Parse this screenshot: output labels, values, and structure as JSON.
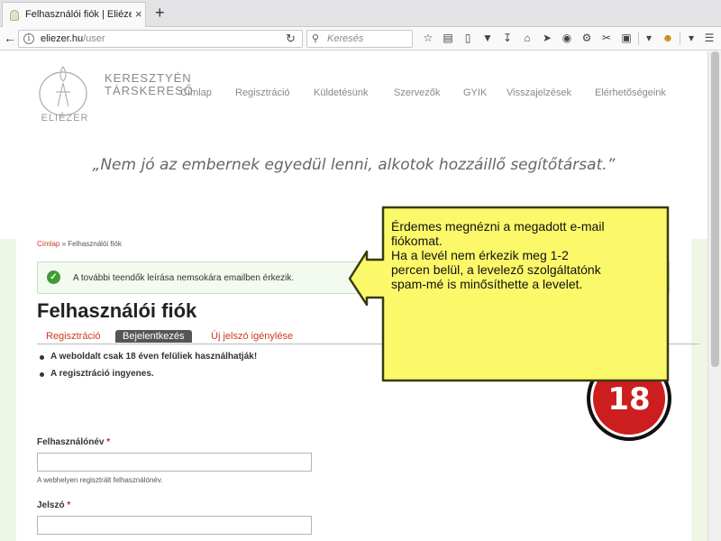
{
  "browser": {
    "tab_title": "Felhasználói fiók | Eliézer -...",
    "tab_close": "×",
    "new_tab": "+",
    "url_host": "eliezer.hu",
    "url_path": "/user",
    "search_placeholder": "Keresés"
  },
  "site": {
    "logo_word": "ELIÉZER",
    "brand_line1": "KERESZTYÉN",
    "brand_line2": "TÁRSKERESŐ",
    "menu": [
      "Címlap",
      "Regisztráció",
      "Küldetésünk",
      "Szervezők",
      "GYIK",
      "Visszajelzések",
      "Elérhetőségeink"
    ],
    "quote": "„Nem jó az embernek egyedül lenni, alkotok hozzáillő segítőtársat.”"
  },
  "breadcrumb": {
    "home": "Címlap",
    "separator": " » ",
    "current": "Felhasználói fiók"
  },
  "status": {
    "message": "A további teendők leírása nemsokára emailben érkezik."
  },
  "main": {
    "title": "Felhasználói fiók",
    "tabs": [
      "Regisztráció",
      "Bejelentkezés",
      "Új jelszó igénylése"
    ],
    "active_tab": "Bejelentkezés",
    "notes": [
      "A weboldalt csak 18 éven felüliek használhatják!",
      "A regisztráció ingyenes."
    ],
    "badge": "18"
  },
  "form": {
    "username_label": "Felhasználónév",
    "username_help": "A webhelyen regisztrált felhasználónév.",
    "password_label": "Jelszó",
    "required_marker": "*"
  },
  "callout": {
    "lines": [
      "Érdemes megnézni a megadott e-mail",
      "fiókomat.",
      "Ha a levél nem érkezik meg 1-2",
      "percen belül, a levelező szolgáltatónk",
      "spam-mé is minősíthette a levelet."
    ],
    "fill_color": "#fbf86a",
    "border_color": "#3a3a10"
  },
  "colors": {
    "accent": "#cc3a1f",
    "success": "#3f9c35",
    "side_green": "#eef7e4"
  }
}
